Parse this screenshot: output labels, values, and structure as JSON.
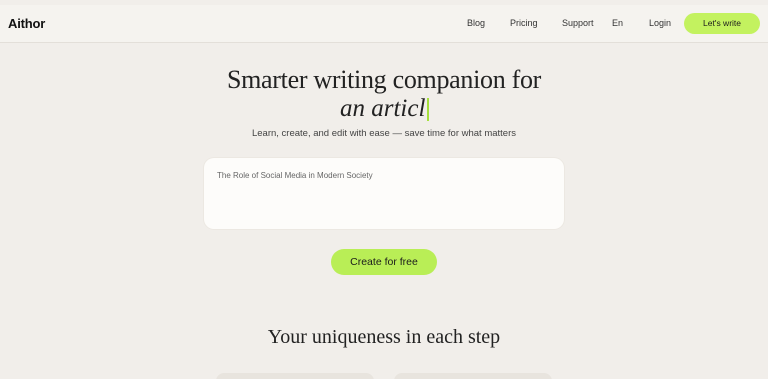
{
  "header": {
    "logo": "Aithor",
    "nav": [
      {
        "label": "Blog"
      },
      {
        "label": "Pricing"
      },
      {
        "label": "Support"
      },
      {
        "label": "En"
      },
      {
        "label": "Login"
      }
    ],
    "cta_label": "Let's write"
  },
  "hero": {
    "title_line1": "Smarter writing companion for",
    "title_line2": "an articl",
    "subtitle": "Learn, create, and edit with ease — save time for what matters"
  },
  "topic_input": {
    "value": "The Role of Social Media in Modern Society"
  },
  "create_button_label": "Create for free",
  "section_title": "Your uniqueness in each step",
  "colors": {
    "accent": "#b9ee56",
    "background": "#f1eeea",
    "card": "#fdfcfa"
  }
}
